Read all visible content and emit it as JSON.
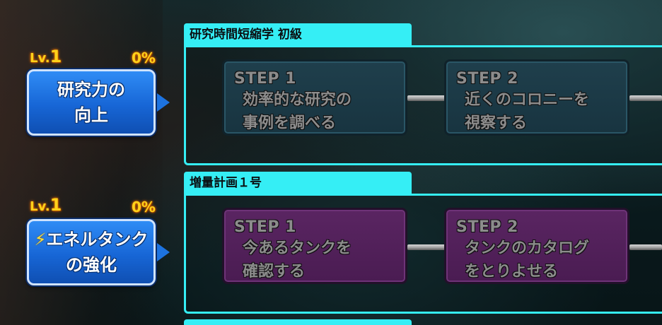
{
  "rows": [
    {
      "level_prefix": "Lv.",
      "level_num": "1",
      "percent": "0%",
      "skill_label": "研究力の\n向上",
      "skill_icon": "",
      "panel_title": "研究時間短縮学 初級",
      "step_color": "#1f3f4c",
      "steps": [
        {
          "label": "STEP 1",
          "desc": "効率的な研究の\n事例を調べる"
        },
        {
          "label": "STEP 2",
          "desc": "近くのコロニーを\n視察する"
        }
      ]
    },
    {
      "level_prefix": "Lv.",
      "level_num": "1",
      "percent": "0%",
      "skill_label": "エネルタンク\nの強化",
      "skill_icon": "⚡",
      "panel_title": "増量計画１号",
      "step_color": "#5a2562",
      "steps": [
        {
          "label": "STEP 1",
          "desc": "今あるタンクを\n確認する"
        },
        {
          "label": "STEP 2",
          "desc": "タンクのカタログ\nをとりよせる"
        }
      ]
    }
  ],
  "colors": {
    "accent": "#35eef5",
    "skill_button": "#1766d6",
    "level_text": "#ffd21a"
  }
}
